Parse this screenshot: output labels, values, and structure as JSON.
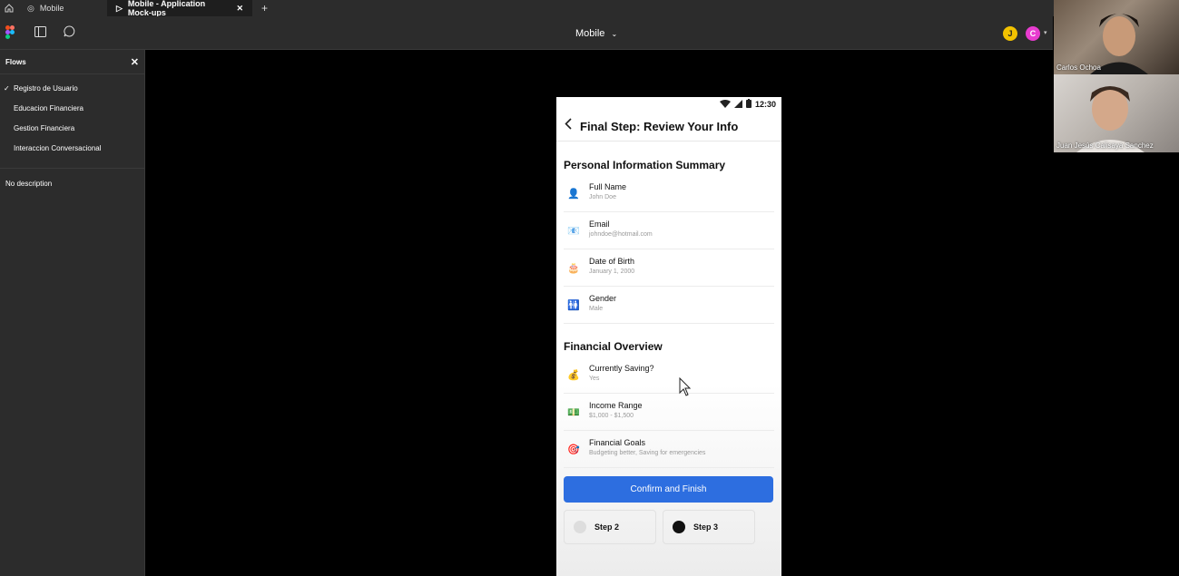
{
  "tabs": [
    {
      "label": "Mobile"
    },
    {
      "label": "Mobile - Application Mock-ups"
    }
  ],
  "toolbar": {
    "file_title": "Mobile"
  },
  "avatars": [
    {
      "initial": "J",
      "color": "#f2c200"
    },
    {
      "initial": "C",
      "color": "#e83ccf"
    }
  ],
  "sidebar": {
    "title": "Flows",
    "flows": [
      {
        "label": "Registro de Usuario",
        "checked": true
      },
      {
        "label": "Educacion Financiera"
      },
      {
        "label": "Gestion Financiera"
      },
      {
        "label": "Interaccion Conversacional"
      }
    ],
    "description": "No description"
  },
  "participants": [
    {
      "name": "Carlos Ochoa"
    },
    {
      "name": "Juan Jesús Calisaya Sanchez"
    }
  ],
  "phone": {
    "time": "12:30",
    "title": "Final Step: Review Your Info",
    "personal_title": "Personal Information Summary",
    "personal": [
      {
        "icon": "👤",
        "icon_name": "user-icon",
        "label": "Full Name",
        "value": "John Doe"
      },
      {
        "icon": "📧",
        "icon_name": "email-icon",
        "label": "Email",
        "value": "johndoe@hotmail.com"
      },
      {
        "icon": "🎂",
        "icon_name": "cake-icon",
        "label": "Date of Birth",
        "value": "January 1, 2000"
      },
      {
        "icon": "🚻",
        "icon_name": "gender-icon",
        "label": "Gender",
        "value": "Male"
      }
    ],
    "financial_title": "Financial Overview",
    "financial": [
      {
        "icon": "💰",
        "icon_name": "money-bag-icon",
        "label": "Currently Saving?",
        "value": "Yes"
      },
      {
        "icon": "💵",
        "icon_name": "cash-icon",
        "label": "Income Range",
        "value": "$1,000 - $1,500"
      },
      {
        "icon": "🎯",
        "icon_name": "target-icon",
        "label": "Financial Goals",
        "value": "Budgeting better, Saving for emergencies"
      }
    ],
    "confirm_label": "Confirm and Finish",
    "steps": [
      {
        "label": "Step 2"
      },
      {
        "label": "Step 3"
      }
    ]
  }
}
